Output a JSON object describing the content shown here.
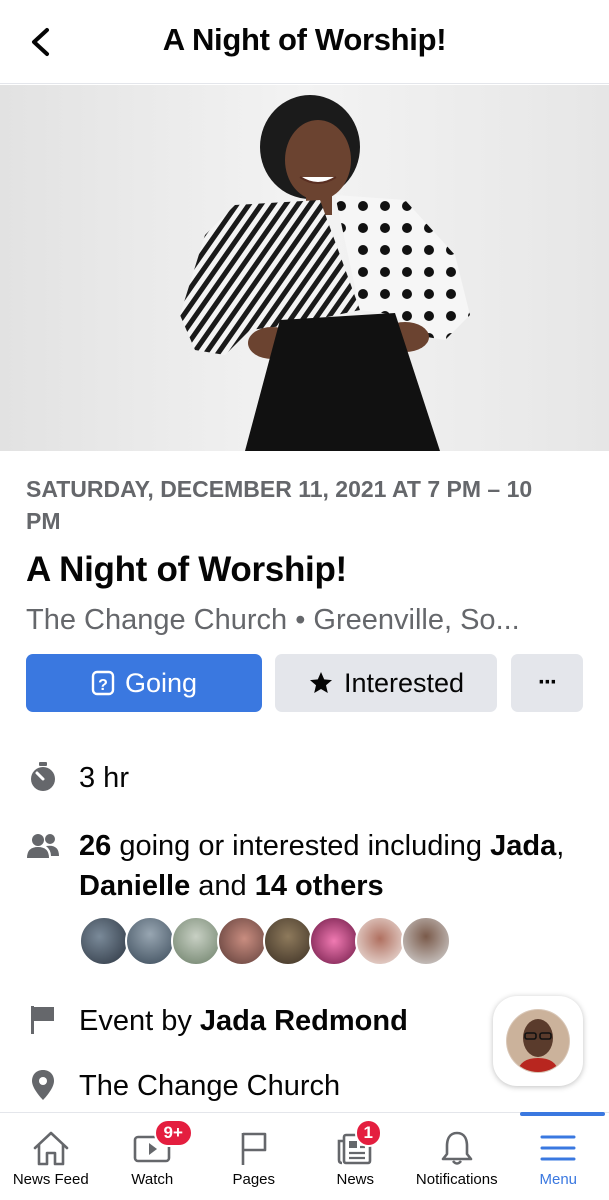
{
  "header": {
    "title": "A Night of Worship!",
    "back_icon": "chevron-left-icon"
  },
  "event": {
    "date": "SATURDAY, DECEMBER 11, 2021 AT 7 PM – 10 PM",
    "title": "A Night of Worship!",
    "place": "The Change Church • Greenville, So..."
  },
  "actions": {
    "going_label": "Going",
    "interested_label": "Interested",
    "more_label": "···"
  },
  "details": {
    "duration": "3 hr",
    "attendees": {
      "count": "26",
      "text_mid": " going or interested including ",
      "name1": "Jada",
      "sep": ",",
      "name2": "Danielle",
      "and": " and ",
      "others": "14 others"
    },
    "host_prefix": "Event by ",
    "host_name": "Jada Redmond",
    "location": "The Change Church"
  },
  "colors": {
    "accent": "#3a78e0",
    "badge": "#e41e3f",
    "muted": "#65676b"
  },
  "tabbar": {
    "items": [
      {
        "label": "News Feed",
        "icon": "home-icon"
      },
      {
        "label": "Watch",
        "icon": "watch-icon",
        "badge": "9+"
      },
      {
        "label": "Pages",
        "icon": "flag-icon"
      },
      {
        "label": "News",
        "icon": "news-icon",
        "badge": "1"
      },
      {
        "label": "Notifications",
        "icon": "bell-icon"
      },
      {
        "label": "Menu",
        "icon": "menu-icon",
        "active": true
      }
    ]
  }
}
